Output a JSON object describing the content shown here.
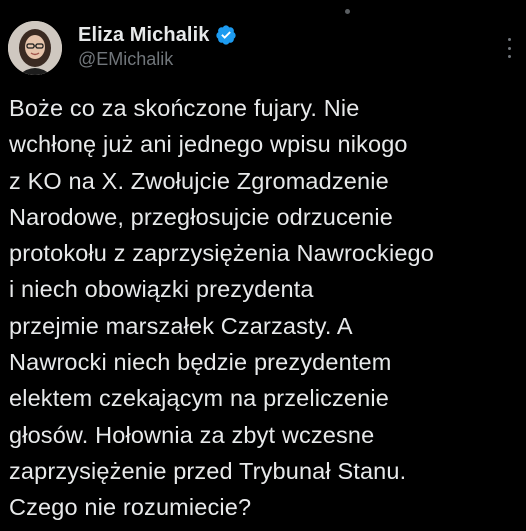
{
  "author": {
    "display_name": "Eliza Michalik",
    "handle": "@EMichalik",
    "verified": true,
    "avatar_icon": "avatar-photo"
  },
  "tweet": {
    "lines": [
      "Boże co za skończone fujary. Nie",
      "wchłonę już ani jednego wpisu nikogo",
      "z KO na X. Zwołujcie Zgromadzenie",
      "Narodowe, przegłosujcie odrzucenie",
      "protokołu z zaprzysiężenia Nawrockiego",
      "i niech obowiązki prezydenta",
      "przejmie marszałek Czarzasty. A",
      "Nawrocki niech będzie prezydentem",
      "elektem czekającym na przeliczenie",
      "głosów. Hołownia za zbyt wczesne",
      "zaprzysiężenie przed Trybunał Stanu.",
      "Czego nie rozumiecie?"
    ]
  },
  "icons": {
    "verified": "verified-badge-icon",
    "more": "more-options-icon"
  },
  "colors": {
    "background": "#000000",
    "primary_text": "#e7e9ea",
    "secondary_text": "#71767b",
    "verified_blue": "#1d9bf0"
  }
}
